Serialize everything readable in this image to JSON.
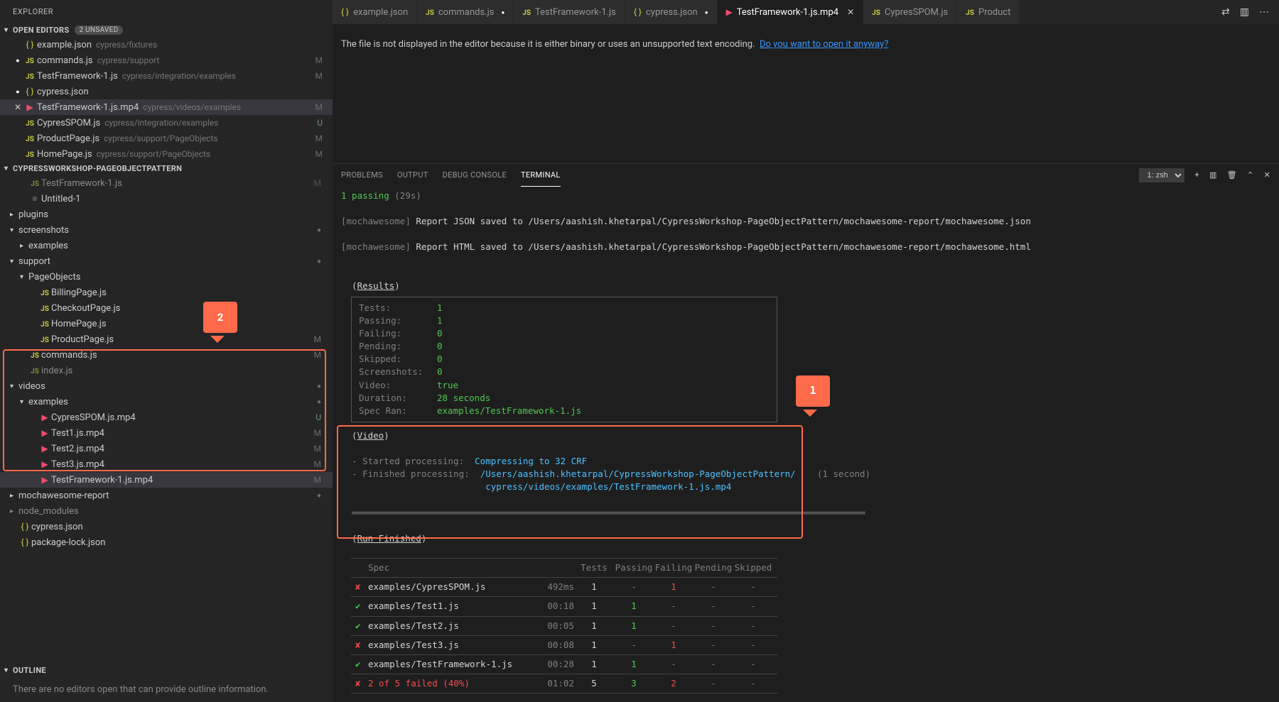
{
  "explorer_title": "EXPLORER",
  "open_editors": {
    "title": "OPEN EDITORS",
    "badge": "2 UNSAVED",
    "items": [
      {
        "pre": "",
        "icon": "json",
        "name": "example.json",
        "path": "cypress/fixtures",
        "status": ""
      },
      {
        "pre": "dot",
        "icon": "js",
        "name": "commands.js",
        "path": "cypress/support",
        "status": "M"
      },
      {
        "pre": "",
        "icon": "js",
        "name": "TestFramework-1.js",
        "path": "cypress/integration/examples",
        "status": "M"
      },
      {
        "pre": "dot",
        "icon": "json",
        "name": "cypress.json",
        "path": "",
        "status": ""
      },
      {
        "pre": "x",
        "icon": "video",
        "name": "TestFramework-1.js.mp4",
        "path": "cypress/videos/examples",
        "status": "M",
        "selected": true
      },
      {
        "pre": "",
        "icon": "js",
        "name": "CypresSPOM.js",
        "path": "cypress/integration/examples",
        "status": "U"
      },
      {
        "pre": "",
        "icon": "js",
        "name": "ProductPage.js",
        "path": "cypress/support/PageObjects",
        "status": "M"
      },
      {
        "pre": "",
        "icon": "js",
        "name": "HomePage.js",
        "path": "cypress/support/PageObjects",
        "status": "M"
      }
    ]
  },
  "workspace": {
    "title": "CYPRESSWORKSHOP-PAGEOBJECTPATTERN",
    "rows": [
      {
        "indent": 1,
        "chev": "",
        "icon": "js",
        "name": "TestFramework-1.js",
        "status": "M",
        "cut": true
      },
      {
        "indent": 1,
        "chev": "",
        "icon": "file",
        "name": "Untitled-1",
        "status": ""
      },
      {
        "indent": 0,
        "chev": "r",
        "icon": "",
        "name": "plugins",
        "status": ""
      },
      {
        "indent": 0,
        "chev": "d",
        "icon": "",
        "name": "screenshots",
        "status": "dot"
      },
      {
        "indent": 1,
        "chev": "r",
        "icon": "",
        "name": "examples",
        "status": ""
      },
      {
        "indent": 0,
        "chev": "d",
        "icon": "",
        "name": "support",
        "status": "dot"
      },
      {
        "indent": 1,
        "chev": "d",
        "icon": "",
        "name": "PageObjects",
        "status": ""
      },
      {
        "indent": 2,
        "chev": "",
        "icon": "js",
        "name": "BillingPage.js",
        "status": ""
      },
      {
        "indent": 2,
        "chev": "",
        "icon": "js",
        "name": "CheckoutPage.js",
        "status": ""
      },
      {
        "indent": 2,
        "chev": "",
        "icon": "js",
        "name": "HomePage.js",
        "status": ""
      },
      {
        "indent": 2,
        "chev": "",
        "icon": "js",
        "name": "ProductPage.js",
        "status": "M"
      },
      {
        "indent": 1,
        "chev": "",
        "icon": "js",
        "name": "commands.js",
        "status": "M"
      },
      {
        "indent": 1,
        "chev": "",
        "icon": "js",
        "name": "index.js",
        "status": "",
        "cut": true
      },
      {
        "indent": 0,
        "chev": "d",
        "icon": "",
        "name": "videos",
        "status": "dot"
      },
      {
        "indent": 1,
        "chev": "d",
        "icon": "",
        "name": "examples",
        "status": "dot"
      },
      {
        "indent": 2,
        "chev": "",
        "icon": "video",
        "name": "CypresSPOM.js.mp4",
        "status": "U"
      },
      {
        "indent": 2,
        "chev": "",
        "icon": "video",
        "name": "Test1.js.mp4",
        "status": "M"
      },
      {
        "indent": 2,
        "chev": "",
        "icon": "video",
        "name": "Test2.js.mp4",
        "status": "M"
      },
      {
        "indent": 2,
        "chev": "",
        "icon": "video",
        "name": "Test3.js.mp4",
        "status": "M"
      },
      {
        "indent": 2,
        "chev": "",
        "icon": "video",
        "name": "TestFramework-1.js.mp4",
        "status": "M",
        "selected": true
      },
      {
        "indent": 0,
        "chev": "r",
        "icon": "",
        "name": "mochawesome-report",
        "status": "dot"
      },
      {
        "indent": 0,
        "chev": "r",
        "icon": "",
        "name": "node_modules",
        "status": "",
        "cut": true
      },
      {
        "indent": 0,
        "chev": "",
        "icon": "json",
        "name": "cypress.json",
        "status": ""
      },
      {
        "indent": 0,
        "chev": "",
        "icon": "json",
        "name": "package-lock.json",
        "status": ""
      }
    ]
  },
  "outline": {
    "title": "OUTLINE",
    "msg": "There are no editors open that can provide outline information."
  },
  "tabs": [
    {
      "icon": "json",
      "label": "example.json"
    },
    {
      "icon": "js",
      "label": "commands.js",
      "dirty": true
    },
    {
      "icon": "js",
      "label": "TestFramework-1.js"
    },
    {
      "icon": "json",
      "label": "cypress.json",
      "dirty": true
    },
    {
      "icon": "video",
      "label": "TestFramework-1.js.mp4",
      "active": true,
      "close": true
    },
    {
      "icon": "js",
      "label": "CypresSPOM.js"
    },
    {
      "icon": "js",
      "label": "Product"
    }
  ],
  "editor_message": {
    "text": "The file is not displayed in the editor because it is either binary or uses an unsupported text encoding.",
    "link": "Do you want to open it anyway?"
  },
  "panel_tabs": [
    "PROBLEMS",
    "OUTPUT",
    "DEBUG CONSOLE",
    "TERMINAL"
  ],
  "panel_active": "TERMINAL",
  "terminal_select": "1: zsh",
  "terminal": {
    "passing": "1 passing",
    "passing_time": "(29s)",
    "report_json": "[mochawesome] Report JSON saved to /Users/aashish.khetarpal/CypressWorkshop-PageObjectPattern/mochawesome-report/mochawesome.json",
    "report_html": "[mochawesome] Report HTML saved to /Users/aashish.khetarpal/CypressWorkshop-PageObjectPattern/mochawesome-report/mochawesome.html",
    "results_label": "Results",
    "results": [
      {
        "k": "Tests:",
        "v": "1"
      },
      {
        "k": "Passing:",
        "v": "1"
      },
      {
        "k": "Failing:",
        "v": "0"
      },
      {
        "k": "Pending:",
        "v": "0"
      },
      {
        "k": "Skipped:",
        "v": "0"
      },
      {
        "k": "Screenshots:",
        "v": "0"
      },
      {
        "k": "Video:",
        "v": "true"
      },
      {
        "k": "Duration:",
        "v": "28 seconds"
      },
      {
        "k": "Spec Ran:",
        "v": "examples/TestFramework-1.js"
      }
    ],
    "video_label": "Video",
    "video_lines": [
      {
        "lead": "-  Started processing:",
        "trail": "Compressing to 32 CRF"
      },
      {
        "lead": "-  Finished processing:",
        "trail": "/Users/aashish.khetarpal/CypressWorkshop-PageObjectPattern/",
        "time": "(1 second)"
      },
      {
        "lead": "",
        "trail": "cypress/videos/examples/TestFramework-1.js.mp4"
      }
    ],
    "run_finished": "Run Finished",
    "spec_header": [
      "Spec",
      "",
      "Tests",
      "Passing",
      "Failing",
      "Pending",
      "Skipped"
    ],
    "spec_rows": [
      {
        "mark": "fail",
        "name": "examples/CypresSPOM.js",
        "dur": "492ms",
        "vals": [
          "1",
          "-",
          "1",
          "-",
          "-"
        ]
      },
      {
        "mark": "pass",
        "name": "examples/Test1.js",
        "dur": "00:18",
        "vals": [
          "1",
          "1",
          "-",
          "-",
          "-"
        ]
      },
      {
        "mark": "pass",
        "name": "examples/Test2.js",
        "dur": "00:05",
        "vals": [
          "1",
          "1",
          "-",
          "-",
          "-"
        ]
      },
      {
        "mark": "fail",
        "name": "examples/Test3.js",
        "dur": "00:08",
        "vals": [
          "1",
          "-",
          "1",
          "-",
          "-"
        ]
      },
      {
        "mark": "pass",
        "name": "examples/TestFramework-1.js",
        "dur": "00:28",
        "vals": [
          "1",
          "1",
          "-",
          "-",
          "-"
        ]
      }
    ],
    "summary": {
      "mark": "fail",
      "name": "2 of 5 failed (40%)",
      "dur": "01:02",
      "vals": [
        "5",
        "3",
        "2",
        "-",
        "-"
      ]
    }
  },
  "callouts": {
    "c1": "1",
    "c2": "2"
  }
}
